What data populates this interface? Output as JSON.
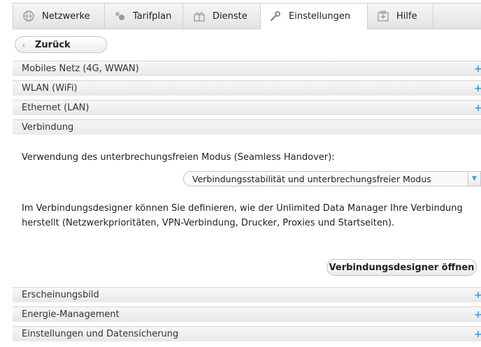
{
  "tabs": [
    {
      "label": "Netzwerke",
      "icon": "globe-icon"
    },
    {
      "label": "Tarifplan",
      "icon": "tarif-icon"
    },
    {
      "label": "Dienste",
      "icon": "gift-icon"
    },
    {
      "label": "Einstellungen",
      "icon": "wrench-icon",
      "active": true
    },
    {
      "label": "Hilfe",
      "icon": "first-aid-icon"
    }
  ],
  "back": {
    "label": "Zurück"
  },
  "sections_top": [
    {
      "label": "Mobiles Netz (4G, WWAN)",
      "expander": "+"
    },
    {
      "label": "WLAN (WiFi)",
      "expander": "+"
    },
    {
      "label": "Ethernet (LAN)",
      "expander": "+"
    }
  ],
  "open_section": {
    "label": "Verbindung"
  },
  "connection": {
    "mode_label": "Verwendung des unterbrechungsfreien Modus (Seamless Handover):",
    "mode_value": "Verbindungsstabilität und unterbrechungsfreier Modus",
    "description": "Im Verbindungsdesigner können Sie definieren, wie der Unlimited Data Manager Ihre Verbindung herstellt (Netzwerkprioritäten, VPN-Verbindung, Drucker, Proxies und Startseiten).",
    "designer_button": "Verbindungsdesigner öffnen"
  },
  "sections_bottom": [
    {
      "label": "Erscheinungsbild",
      "expander": "+"
    },
    {
      "label": "Energie-Management",
      "expander": "+"
    },
    {
      "label": "Einstellungen und Datensicherung",
      "expander": "+"
    }
  ],
  "colors": {
    "accent": "#3aa0e0",
    "header_bg": "#ececec",
    "border": "#cfcfcf"
  }
}
